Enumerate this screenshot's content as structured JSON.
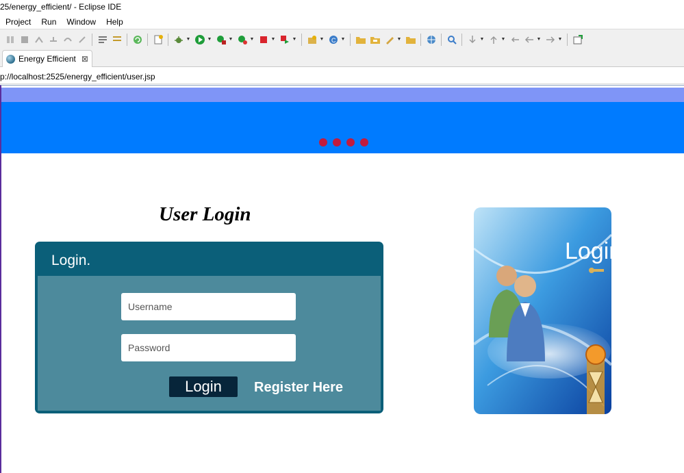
{
  "window": {
    "title": "25/energy_efficient/ - Eclipse IDE"
  },
  "menu": {
    "items": [
      "Project",
      "Run",
      "Window",
      "Help"
    ]
  },
  "toolbar": {
    "icons": [
      "skip-icon",
      "stop-icon",
      "disconnect-icon",
      "step-into-icon",
      "step-over-icon",
      "step-return-icon",
      "task-icon",
      "format-icon",
      "refresh-icon",
      "new-icon",
      "debug-icon",
      "run-icon",
      "coverage-icon",
      "profile-icon",
      "stop-server-icon",
      "external-tools-icon",
      "new-java-icon",
      "new-class-icon",
      "open-folder-icon",
      "open-type-icon",
      "pencil-icon",
      "folder-icon",
      "globe-icon",
      "search-icon",
      "next-annotation-icon",
      "prev-annotation-icon",
      "last-edit-icon",
      "back-icon",
      "forward-icon",
      "pin-icon"
    ]
  },
  "tab": {
    "label": "Energy Efficient",
    "close_glyph": "⊠"
  },
  "browser": {
    "url": "p://localhost:2525/energy_efficient/user.jsp"
  },
  "page": {
    "heading": "User Login",
    "panel_title": "Login.",
    "username_placeholder": "Username",
    "password_placeholder": "Password",
    "login_button": "Login",
    "register_link": "Register Here",
    "image_text": "Login"
  },
  "colors": {
    "banner": "#007bff",
    "stripe": "#7f95f7",
    "dots": "#c21b3e",
    "panel_header": "#0b5f79",
    "panel_body": "#4d8a9c",
    "login_button": "#07253a"
  }
}
